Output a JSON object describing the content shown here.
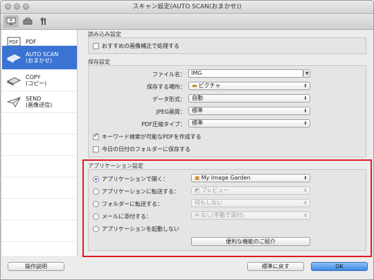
{
  "window": {
    "title": "スキャン設定(AUTO SCAN(おまかせ))"
  },
  "sidebar": {
    "items": [
      {
        "label": "PDF",
        "sublabel": "",
        "icon": "pdf-icon"
      },
      {
        "label": "AUTO SCAN",
        "sublabel": "(おまかせ)",
        "icon": "auto-scan-icon"
      },
      {
        "label": "COPY",
        "sublabel": "(コピー)",
        "icon": "copy-icon"
      },
      {
        "label": "SEND",
        "sublabel": "(画像送信)",
        "icon": "send-icon"
      }
    ]
  },
  "read_settings": {
    "title": "読み込み設定",
    "recommended_correction": "おすすめの画像補正で処理する"
  },
  "save_settings": {
    "title": "保存設定",
    "file_name_label": "ファイル名：",
    "file_name_value": "IMG",
    "save_location_label": "保存する場所：",
    "save_location_value": "ピクチャ",
    "data_format_label": "データ形式：",
    "data_format_value": "自動",
    "jpeg_quality_label": "JPEG画質：",
    "jpeg_quality_value": "標準",
    "pdf_compression_label": "PDF圧縮タイプ：",
    "pdf_compression_value": "標準",
    "searchable_pdf": "キーワード検索が可能なPDFを作成する",
    "today_folder": "今日の日付のフォルダーに保存する"
  },
  "app_settings": {
    "title": "アプリケーション設定",
    "open_with_label": "アプリケーションで開く：",
    "open_with_value": "My Image Garden",
    "send_to_app_label": "アプリケーションに転送する：",
    "send_to_app_value": "プレビュー",
    "send_to_folder_label": "フォルダーに転送する：",
    "send_to_folder_value": "何もしない",
    "attach_email_label": "メールに添付する：",
    "attach_email_value": "なし(手動で添付)",
    "do_not_start_label": "アプリケーションを起動しない",
    "useful_features_button": "便利な機能のご紹介"
  },
  "footer": {
    "instructions_button": "操作説明",
    "defaults_button": "標準に戻す",
    "ok_button": "OK"
  }
}
